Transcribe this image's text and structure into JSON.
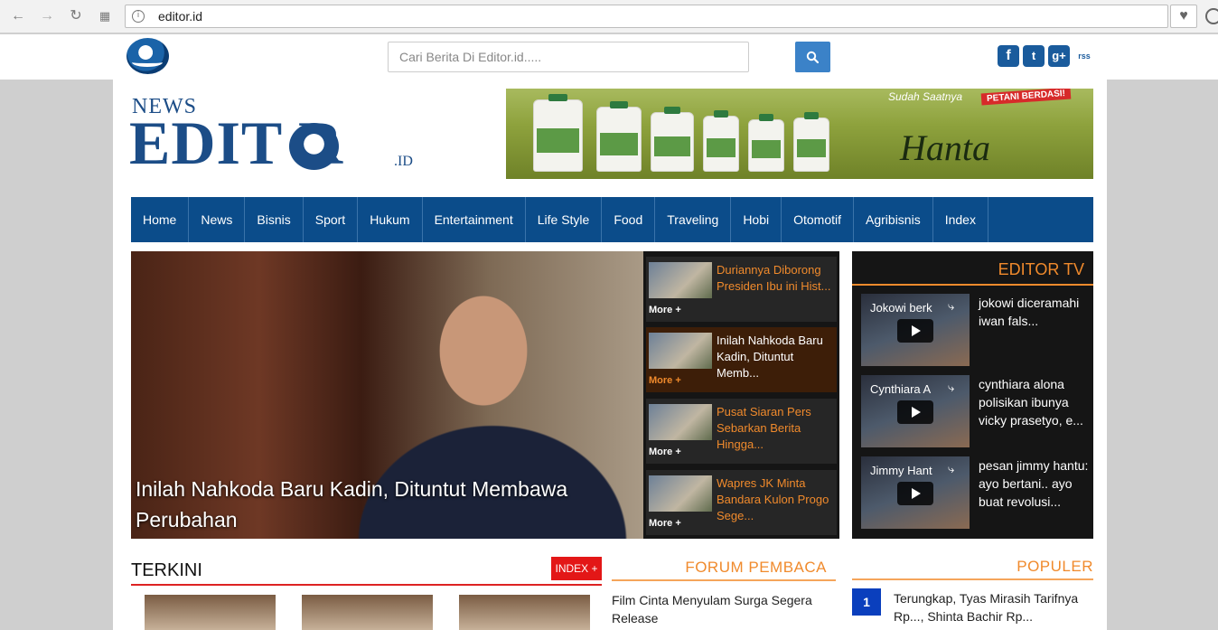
{
  "browser": {
    "url": "editor.id"
  },
  "search": {
    "placeholder": "Cari Berita Di Editor.id....."
  },
  "social": [
    "f",
    "t",
    "g+",
    "rss"
  ],
  "masthead": {
    "news": "NEWS",
    "editor": "EDIT R",
    "tld": ".ID"
  },
  "banner": {
    "tagline": "Sudah Saatnya",
    "ribbon": "PETANI BERDASI!",
    "brand": "Hanta"
  },
  "nav": [
    "Home",
    "News",
    "Bisnis",
    "Sport",
    "Hukum",
    "Entertainment",
    "Life Style",
    "Food",
    "Traveling",
    "Hobi",
    "Otomotif",
    "Agribisnis",
    "Index"
  ],
  "headline": {
    "caption_line1": "Inilah Nahkoda Baru Kadin, Dituntut Membawa",
    "caption_line2": "Perubahan"
  },
  "side_list": [
    {
      "title": "Duriannya Diborong Presiden Ibu ini Hist...",
      "more": "More +",
      "active": false
    },
    {
      "title": "Inilah Nahkoda Baru Kadin, Dituntut Memb...",
      "more": "More +",
      "active": true
    },
    {
      "title": "Pusat Siaran Pers Sebarkan Berita Hingga...",
      "more": "More +",
      "active": false
    },
    {
      "title": "Wapres JK Minta Bandara Kulon Progo Sege...",
      "more": "More +",
      "active": false
    }
  ],
  "editor_tv": {
    "title": "EDITOR TV",
    "items": [
      {
        "video_title": "Jokowi berk",
        "desc": "jokowi diceramahi iwan fals..."
      },
      {
        "video_title": "Cynthiara A",
        "desc": "cynthiara alona polisikan ibunya vicky prasetyo, e..."
      },
      {
        "video_title": "Jimmy Hant",
        "desc": "pesan jimmy hantu: ayo bertani.. ayo buat revolusi..."
      }
    ]
  },
  "terkini": {
    "title": "TERKINI",
    "index_label": "INDEX +"
  },
  "forum": {
    "title": "FORUM PEMBACA",
    "item": "Film Cinta Menyulam Surga Segera Release"
  },
  "populer": {
    "title": "POPULER",
    "rank": "1",
    "item": "Terungkap, Tyas Mirasih Tarifnya Rp..., Shinta Bachir Rp..."
  }
}
